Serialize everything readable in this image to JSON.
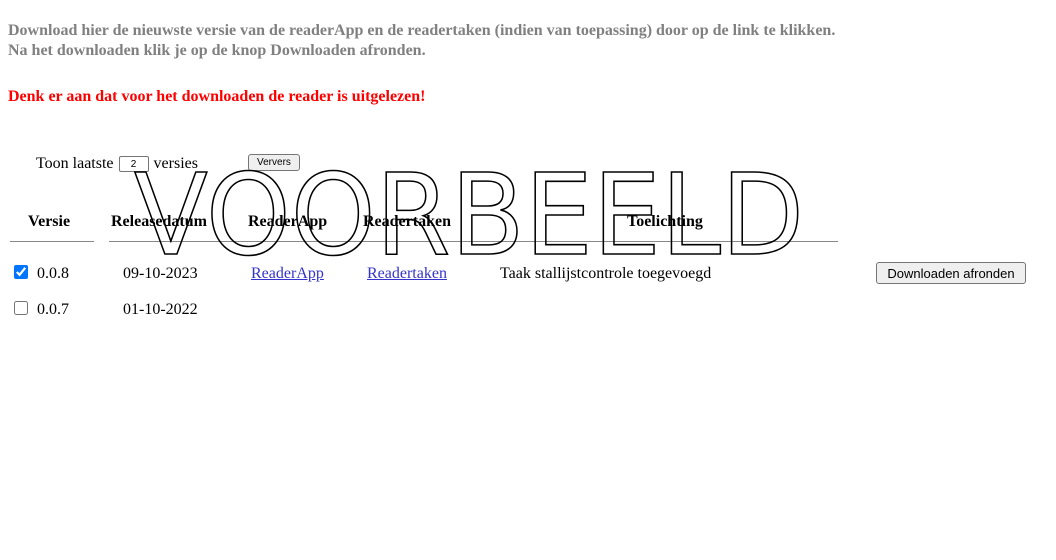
{
  "intro": {
    "line1": "Download hier de nieuwste versie van de readerApp en de readertaken (indien van toepassing) door op de link te klikken.",
    "line2": "Na het downloaden klik je op de knop Downloaden afronden."
  },
  "warning": "Denk er aan dat voor het downloaden de reader is uitgelezen!",
  "filter": {
    "prefix": "Toon laatste",
    "count": "2",
    "suffix": "versies",
    "refresh_label": "Ververs"
  },
  "table": {
    "headers": [
      "Versie",
      "Releasedatum",
      "ReaderApp",
      "Readertaken",
      "Toelichting"
    ],
    "rows": [
      {
        "checked": true,
        "version": "0.0.8",
        "date": "09-10-2023",
        "app_link": "ReaderApp",
        "tasks_link": "Readertaken",
        "note": "Taak stallijstcontrole toegevoegd"
      },
      {
        "checked": false,
        "version": "0.0.7",
        "date": "01-10-2022",
        "app_link": "",
        "tasks_link": "",
        "note": ""
      }
    ]
  },
  "finish_button": "Downloaden afronden",
  "watermark": "VOORBEELD",
  "colors": {
    "intro_text": "#808080",
    "warning_text": "#ff0000",
    "link": "#3333cc"
  }
}
